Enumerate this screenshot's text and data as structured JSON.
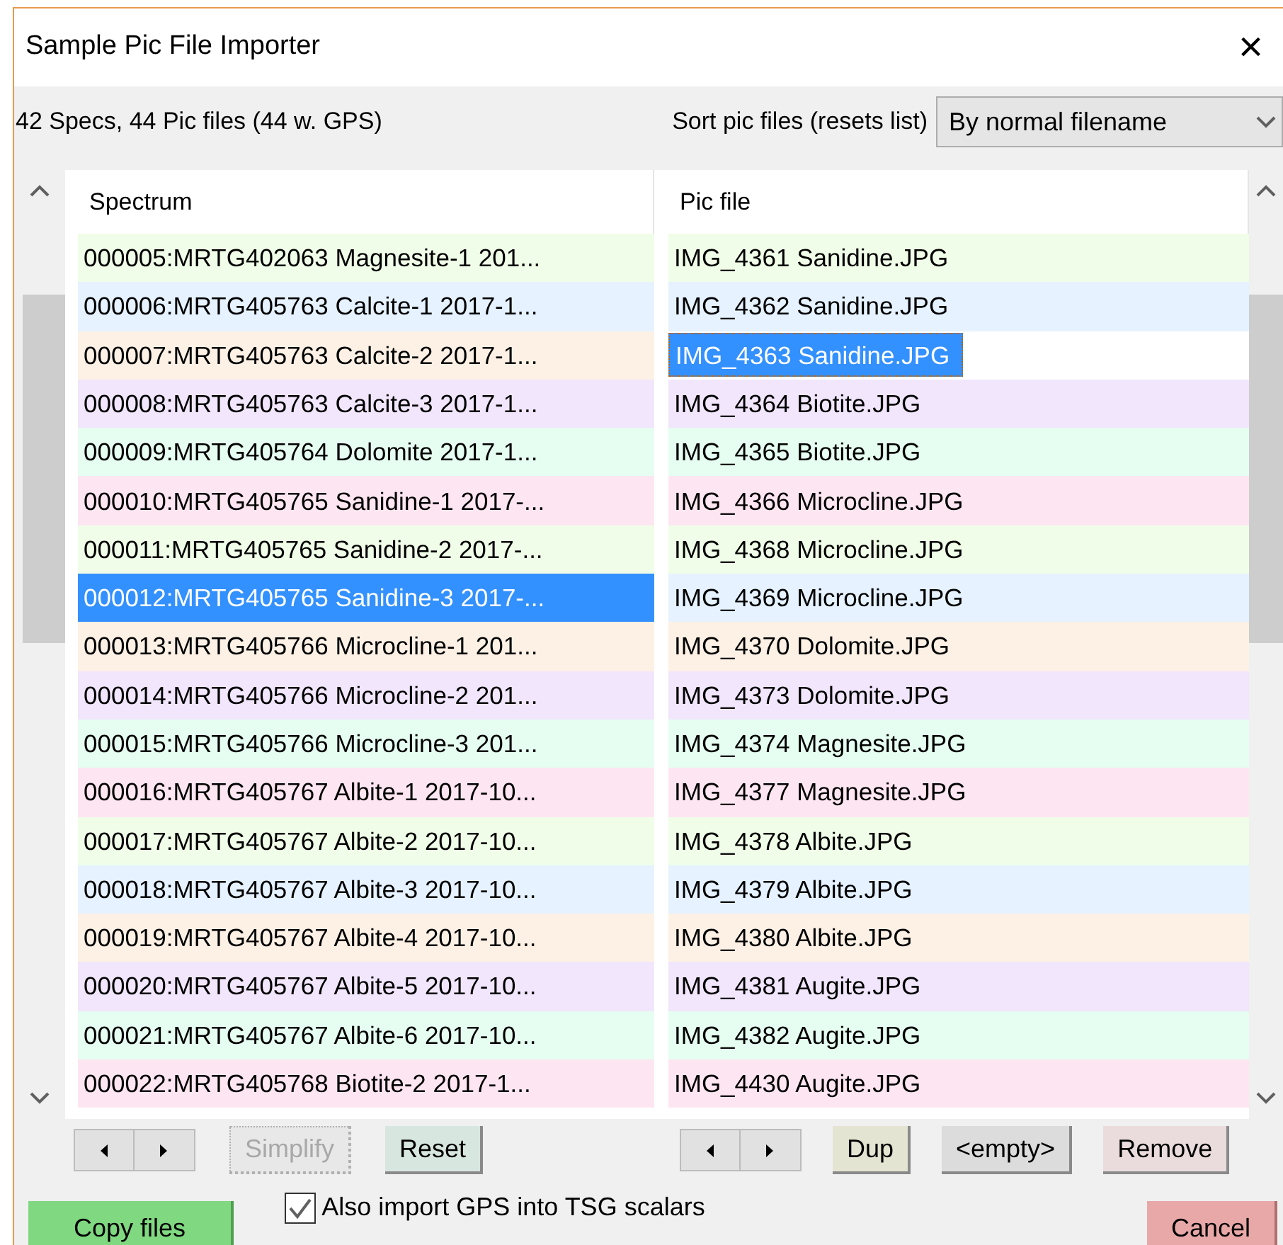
{
  "window": {
    "title": "Sample Pic File Importer",
    "close": "×"
  },
  "summary": "42 Specs,  44 Pic files (44 w. GPS)",
  "sort": {
    "label": "Sort pic files (resets list)",
    "value": "By normal filename"
  },
  "spectra": {
    "column": "Spectrum",
    "rows": [
      {
        "text": "000005:MRTG402063 Magnesite-1 201...",
        "color": "#f0fde8",
        "selected": false
      },
      {
        "text": "000006:MRTG405763 Calcite-1 2017-1...",
        "color": "#e6f2ff",
        "selected": false
      },
      {
        "text": "000007:MRTG405763 Calcite-2 2017-1...",
        "color": "#fdf1e6",
        "selected": false
      },
      {
        "text": "000008:MRTG405763 Calcite-3 2017-1...",
        "color": "#f1e6fb",
        "selected": false
      },
      {
        "text": "000009:MRTG405764 Dolomite 2017-1...",
        "color": "#e6fdf1",
        "selected": false
      },
      {
        "text": "000010:MRTG405765 Sanidine-1 2017-...",
        "color": "#fde6f1",
        "selected": false
      },
      {
        "text": "000011:MRTG405765 Sanidine-2 2017-...",
        "color": "#f0fde8",
        "selected": false
      },
      {
        "text": "000012:MRTG405765 Sanidine-3 2017-...",
        "selected": true
      },
      {
        "text": "000013:MRTG405766 Microcline-1 201...",
        "color": "#fdf1e6",
        "selected": false
      },
      {
        "text": "000014:MRTG405766 Microcline-2 201...",
        "color": "#f1e6fb",
        "selected": false
      },
      {
        "text": "000015:MRTG405766 Microcline-3 201...",
        "color": "#e6fdf1",
        "selected": false
      },
      {
        "text": "000016:MRTG405767 Albite-1 2017-10...",
        "color": "#fde6f1",
        "selected": false
      },
      {
        "text": "000017:MRTG405767 Albite-2 2017-10...",
        "color": "#f0fde8",
        "selected": false
      },
      {
        "text": "000018:MRTG405767 Albite-3 2017-10...",
        "color": "#e6f2ff",
        "selected": false
      },
      {
        "text": "000019:MRTG405767 Albite-4 2017-10...",
        "color": "#fdf1e6",
        "selected": false
      },
      {
        "text": "000020:MRTG405767 Albite-5 2017-10...",
        "color": "#f1e6fb",
        "selected": false
      },
      {
        "text": "000021:MRTG405767 Albite-6 2017-10...",
        "color": "#e6fdf1",
        "selected": false
      },
      {
        "text": "000022:MRTG405768 Biotite-2 2017-1...",
        "color": "#fde6f1",
        "selected": false
      }
    ]
  },
  "pic_files": {
    "column": "Pic file",
    "rows": [
      {
        "text": "IMG_4361 Sanidine.JPG",
        "color": "#f0fde8",
        "selected": false
      },
      {
        "text": "IMG_4362 Sanidine.JPG",
        "color": "#e6f2ff",
        "selected": false
      },
      {
        "text": "IMG_4363 Sanidine.JPG",
        "selected": true
      },
      {
        "text": "IMG_4364 Biotite.JPG",
        "color": "#f1e6fb",
        "selected": false
      },
      {
        "text": "IMG_4365 Biotite.JPG",
        "color": "#e6fdf1",
        "selected": false
      },
      {
        "text": "IMG_4366 Microcline.JPG",
        "color": "#fde6f1",
        "selected": false
      },
      {
        "text": "IMG_4368 Microcline.JPG",
        "color": "#f0fde8",
        "selected": false
      },
      {
        "text": "IMG_4369 Microcline.JPG",
        "color": "#e6f2ff",
        "selected": false
      },
      {
        "text": "IMG_4370 Dolomite.JPG",
        "color": "#fdf1e6",
        "selected": false
      },
      {
        "text": "IMG_4373 Dolomite.JPG",
        "color": "#f1e6fb",
        "selected": false
      },
      {
        "text": "IMG_4374 Magnesite.JPG",
        "color": "#e6fdf1",
        "selected": false
      },
      {
        "text": "IMG_4377 Magnesite.JPG",
        "color": "#fde6f1",
        "selected": false
      },
      {
        "text": "IMG_4378 Albite.JPG",
        "color": "#f0fde8",
        "selected": false
      },
      {
        "text": "IMG_4379 Albite.JPG",
        "color": "#e6f2ff",
        "selected": false
      },
      {
        "text": "IMG_4380 Albite.JPG",
        "color": "#fdf1e6",
        "selected": false
      },
      {
        "text": "IMG_4381 Augite.JPG",
        "color": "#f1e6fb",
        "selected": false
      },
      {
        "text": "IMG_4382 Augite.JPG",
        "color": "#e6fdf1",
        "selected": false
      },
      {
        "text": "IMG_4430 Augite.JPG",
        "color": "#fde6f1",
        "selected": false
      }
    ]
  },
  "left_buttons": [
    {
      "label": "Simplify",
      "color": "#e8e8e8",
      "disabled": true
    },
    {
      "label": "Reset",
      "color": "#d8e6e0",
      "disabled": false
    }
  ],
  "right_buttons": [
    {
      "label": "Dup",
      "color": "#e4e4d2",
      "disabled": false
    },
    {
      "label": "<empty>",
      "color": "#dcdcdc",
      "disabled": false
    },
    {
      "label": "Remove",
      "color": "#eadcdc",
      "disabled": false
    }
  ],
  "gps_option": {
    "label": "Also import GPS into TSG scalars",
    "checked": true
  },
  "copy_button": {
    "label": "Copy files",
    "color": "#80d880"
  },
  "cancel_button": {
    "label": "Cancel",
    "color": "#e8a8a8"
  }
}
